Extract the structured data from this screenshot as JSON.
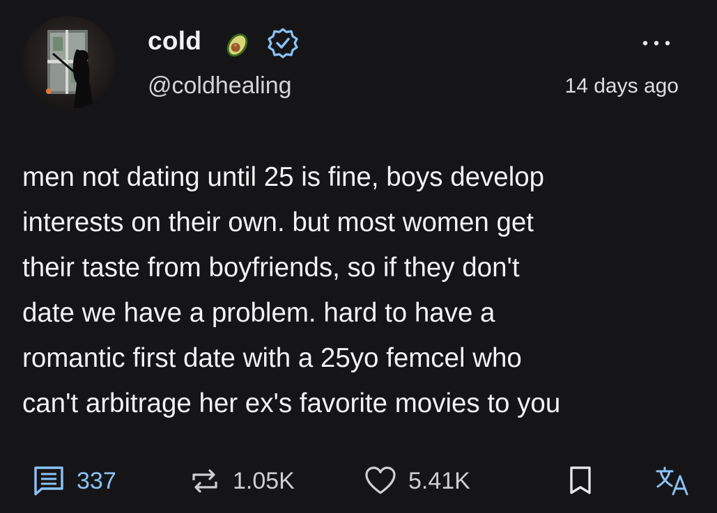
{
  "author": {
    "display_name": "cold",
    "emoji": "avocado",
    "verified_icon": "verified-badge-icon",
    "handle": "@coldhealing"
  },
  "timestamp": "14 days ago",
  "post": {
    "lines": [
      "men not dating until 25 is fine, boys develop",
      "interests on their own. but most women get",
      "their taste from boyfriends, so if they don't",
      "date we have a problem. hard to have a",
      "romantic first date with a 25yo femcel who",
      "can't arbitrage her ex's favorite movies to you"
    ]
  },
  "actions": {
    "comments": "337",
    "reposts": "1.05K",
    "likes": "5.41K"
  },
  "icons": {
    "more": "more-icon",
    "comment": "comment-icon",
    "repost": "repost-icon",
    "like": "heart-icon",
    "bookmark": "bookmark-icon",
    "translate": "translate-icon"
  },
  "colors": {
    "background": "#151518",
    "accent": "#8cc3f5",
    "text": "#f3f3f3",
    "muted": "#cfcfcf"
  }
}
